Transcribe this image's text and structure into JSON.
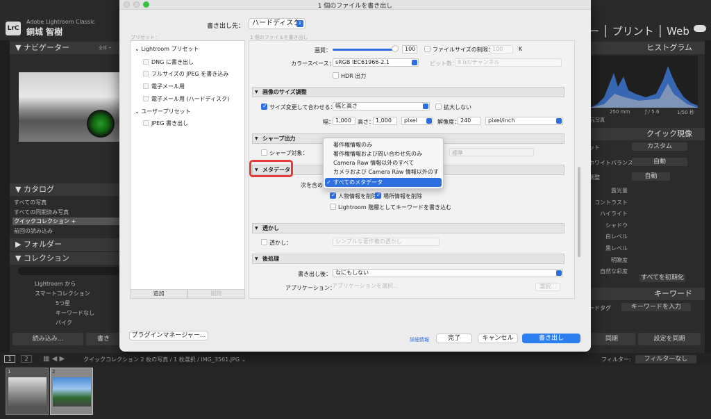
{
  "lr": {
    "logo": "LrC",
    "app_name": "Adobe Lightroom Classic",
    "user": "銅城 智樹",
    "modules": "ー │ プリント │ Web",
    "navigator": "ナビゲーター",
    "nav_zoom": "全体 ÷",
    "catalog": "カタログ",
    "catalog_items": [
      "すべての写真",
      "すべての同期済み写真",
      "クイックコレクション +",
      "前回の読み込み"
    ],
    "folders": "フォルダー",
    "collections": "コレクション",
    "collection_items": [
      "Lightroom から",
      "スマートコレクション",
      "5つ星",
      "キーワードなし",
      "バイク"
    ],
    "import_btn": "読み込み...",
    "export_btn_partial": "書き",
    "histogram": "ヒストグラム",
    "histo_info": [
      "250 mm",
      "ƒ / 5.6",
      "1/50 秒"
    ],
    "original_photo": "元写真",
    "quick_develop": "クイック現像",
    "qd_rows": [
      {
        "label": "ット",
        "value": "カスタム"
      },
      {
        "label": "ホワイトバランス",
        "value": "自動"
      },
      {
        "label": "調整",
        "value": "自動"
      }
    ],
    "qd_sliders": [
      "露光量",
      "コントラスト",
      "ハイライト",
      "シャドウ",
      "白レベル",
      "黒レベル",
      "明瞭度",
      "自然な彩度"
    ],
    "reset_all": "すべてを初期化",
    "keywords": "キーワード",
    "keyword_tag": "ードタグ",
    "keyword_enter": "キーワードを入力",
    "sync": "同期",
    "sync_settings": "設定を同期",
    "bottom_bar": "クイックコレクション  2 枚の写真 / 1 枚選択 / IMG_3561.JPG ⌄",
    "filter_label": "フィルター:",
    "filter_value": "フィルターなし",
    "page_1": "1",
    "page_2": "2",
    "thumb_nums": [
      "1",
      "2"
    ]
  },
  "dialog": {
    "title": "1 個のファイルを書き出し",
    "dest_label": "書き出し先：",
    "dest_value": "ハードディスク",
    "preset_label": "プリセット：",
    "file_count": "1 個のファイルを書き出し",
    "presets": {
      "lr_group": "Lightroom プリセット",
      "items": [
        "DNG に書き出し",
        "フルサイズの JPEG を書き込み",
        "電子メール用",
        "電子メール用 (ハードディスク)"
      ],
      "user_group": "ユーザープリセット",
      "user_items": [
        "JPEG 書き出し"
      ]
    },
    "add_btn": "追加",
    "remove_btn": "削除",
    "quality_label": "画質：",
    "quality_value": "100",
    "limit_size": "ファイルサイズの制限：",
    "limit_value": "100",
    "limit_unit": "K",
    "colorspace_label": "カラースペース：",
    "colorspace_value": "sRGB IEC61966-2.1",
    "bitdepth_label": "ビット数：",
    "bitdepth_value": "8 bit/チャンネル",
    "hdr": "HDR 出力",
    "resize_head": "画像のサイズ調整",
    "resize_fit": "サイズ変更して合わせる：",
    "resize_mode": "幅と高さ",
    "enlarge": "拡大しない",
    "width_label": "幅：",
    "width_value": "1,000",
    "height_label": "高さ：",
    "height_value": "1,000",
    "px_unit": "pixel",
    "res_label": "解像度：",
    "res_value": "240",
    "res_unit": "pixel/inch",
    "sharpen_head": "シャープ出力",
    "sharpen_target": "シャープ対象：",
    "sharpen_amount": "標準",
    "metadata_head": "メタデータ",
    "include_label": "次を含める",
    "remove_person": "人物情報を削除",
    "remove_location": "場所情報を削除",
    "write_keywords": "Lightroom 階層としてキーワードを書き込む",
    "metadata_options": [
      "著作権情報のみ",
      "著作権情報および問い合わせ先のみ",
      "Camera Raw 情報以外のすべて",
      "カメラおよび Camera Raw 情報以外のすべて",
      "すべてのメタデータ"
    ],
    "watermark_head": "透かし",
    "watermark_label": "透かし：",
    "watermark_value": "シンプルな著作権の透かし",
    "post_head": "後処理",
    "after_export_label": "書き出し後：",
    "after_export_value": "なにもしない",
    "application_label": "アプリケーション：",
    "application_placeholder": "アプリケーションを選択...",
    "choose_btn": "選択...",
    "plugin_btn": "プラグインマネージャー...",
    "info_link": "詳細情報",
    "done_btn": "完了",
    "cancel_btn": "キャンセル",
    "export_btn": "書き出し"
  },
  "colors": {
    "accent": "#2d6fe0",
    "highlight": "#e53a3a"
  }
}
